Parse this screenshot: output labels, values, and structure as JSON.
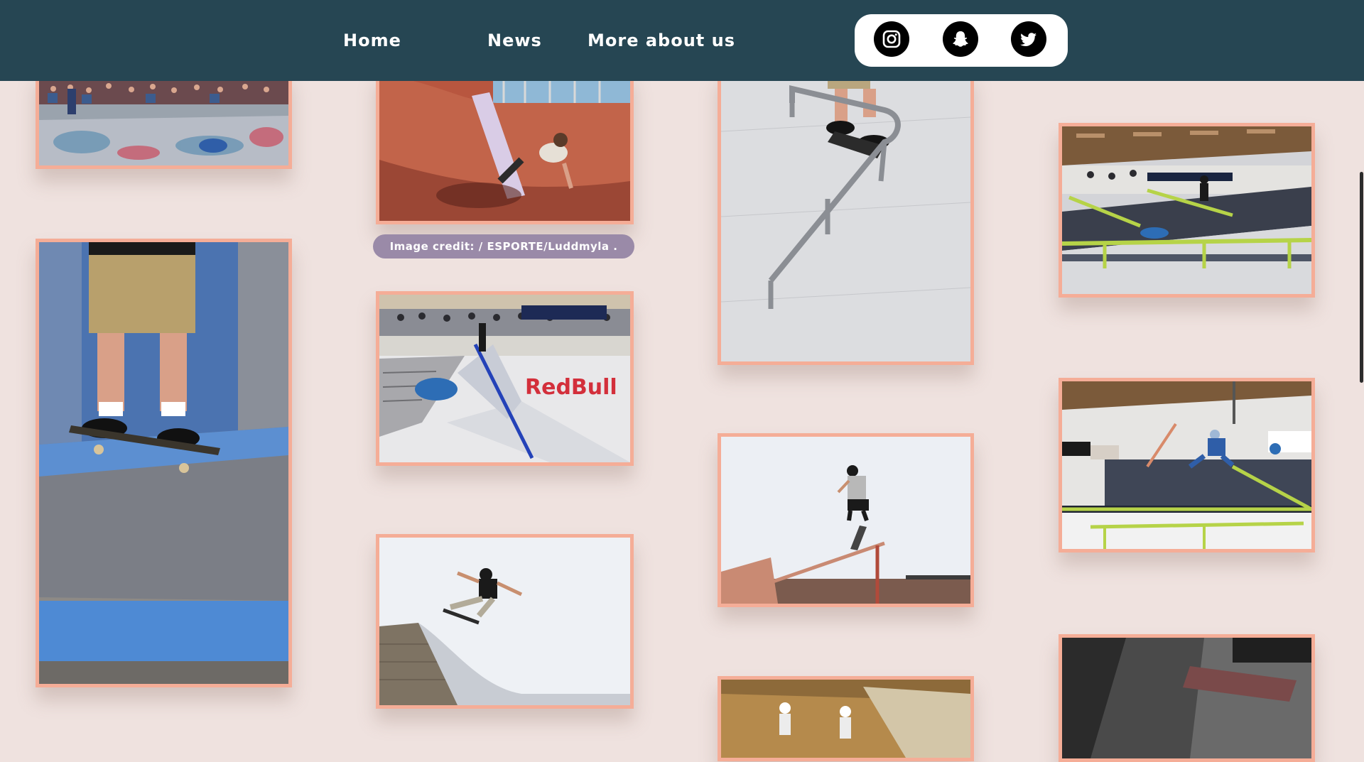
{
  "nav": {
    "links": [
      "Home",
      "News",
      "More about us"
    ],
    "social": [
      {
        "name": "instagram",
        "icon": "instagram-icon"
      },
      {
        "name": "snapchat",
        "icon": "snapchat-icon"
      },
      {
        "name": "twitter",
        "icon": "twitter-icon"
      }
    ],
    "colors": {
      "bar": "#264653",
      "text": "#ffffff",
      "social_bg": "#ffffff",
      "social_icon": "#000000"
    }
  },
  "gallery": {
    "frame_color": "#f5ad97",
    "background": "#efe2df",
    "images": [
      {
        "name": "skatepark-crowd-bowl-image"
      },
      {
        "name": "skater-bowl-wall-image"
      },
      {
        "name": "skater-rail-grind-image"
      },
      {
        "name": "indoor-park-contest-image"
      },
      {
        "name": "skater-feet-on-board-image"
      },
      {
        "name": "redbull-park-rail-image"
      },
      {
        "name": "indoor-kickflip-rails-image"
      },
      {
        "name": "skater-jump-over-rail-image"
      },
      {
        "name": "skater-air-ramp-image"
      },
      {
        "name": "downhill-skaters-image"
      },
      {
        "name": "dark-close-up-image"
      }
    ]
  },
  "credit": {
    "text": "Image credit: / ESPORTE/Luddmyla ."
  }
}
